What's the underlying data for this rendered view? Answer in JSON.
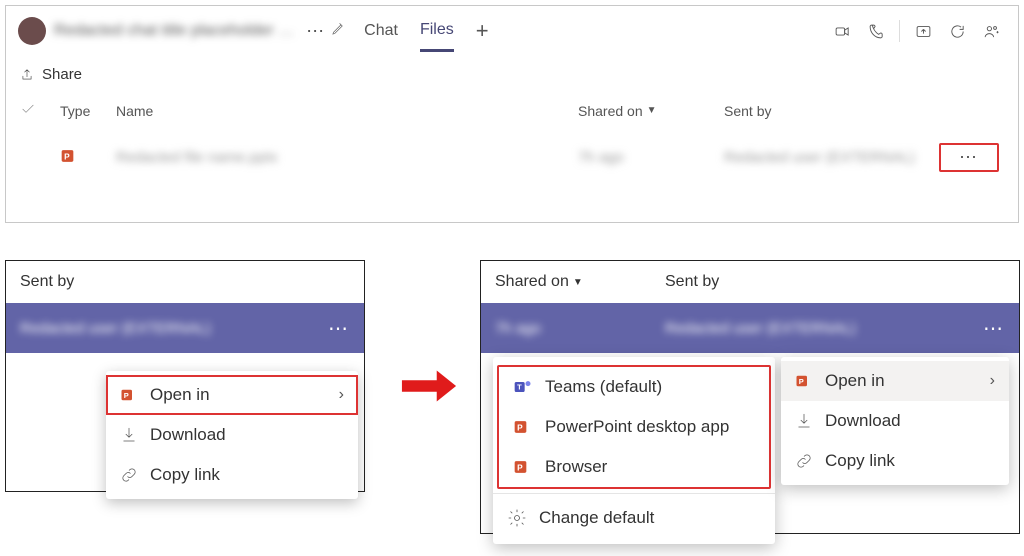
{
  "header": {
    "chat_title": "Redacted chat title placeholder …",
    "more": "⋯",
    "tabs": {
      "chat": "Chat",
      "files": "Files",
      "active": "files"
    }
  },
  "share_label": "Share",
  "columns": {
    "type": "Type",
    "name": "Name",
    "shared_on": "Shared on",
    "sent_by": "Sent by"
  },
  "row1": {
    "name": "Redacted file name.pptx",
    "shared_on": "7h ago",
    "sent_by": "Redacted user (EXTERNAL)",
    "more": "⋯"
  },
  "bl": {
    "heading": "Sent by",
    "row_text": "Redacted user (EXTERNAL)",
    "dots": "⋯",
    "menu": {
      "open_in": "Open in",
      "download": "Download",
      "copy_link": "Copy link"
    }
  },
  "br": {
    "shared_on": "Shared on",
    "sent_by": "Sent by",
    "col1_val": "7h ago",
    "col2_val": "Redacted user (EXTERNAL)",
    "dots": "⋯",
    "submenu": {
      "teams": "Teams (default)",
      "desktop": "PowerPoint desktop app",
      "browser": "Browser",
      "change_default": "Change default"
    },
    "menu": {
      "open_in": "Open in",
      "download": "Download",
      "copy_link": "Copy link"
    }
  }
}
